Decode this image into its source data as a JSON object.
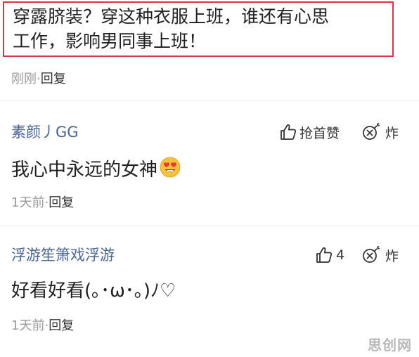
{
  "quote": {
    "line1": "穿露脐装？穿这种衣服上班，谁还有心思",
    "line2": "工作，影响男同事上班！"
  },
  "post_meta": {
    "time": "刚刚",
    "separator": "·",
    "reply": "回复"
  },
  "comments": [
    {
      "username": "素颜丿GG",
      "text": "我心中永远的女神",
      "emoji": "heart-eyes-emoji",
      "like_label": "抢首赞",
      "bomb_label": "炸",
      "time": "1天前",
      "separator": "·",
      "reply": "回复"
    },
    {
      "username": "浮游笙箫戏浮游",
      "text": "好看好看(｡･ω･｡)ﾉ♡",
      "like_label": "4",
      "bomb_label": "炸",
      "time": "1天前",
      "separator": "·",
      "reply": "回复"
    }
  ],
  "watermark": "思创网",
  "colors": {
    "highlight_border": "#d9343f",
    "username": "#4a6591",
    "meta_gray": "#9a9a9a"
  },
  "icons": [
    "thumbs-up-icon",
    "bomb-icon"
  ]
}
